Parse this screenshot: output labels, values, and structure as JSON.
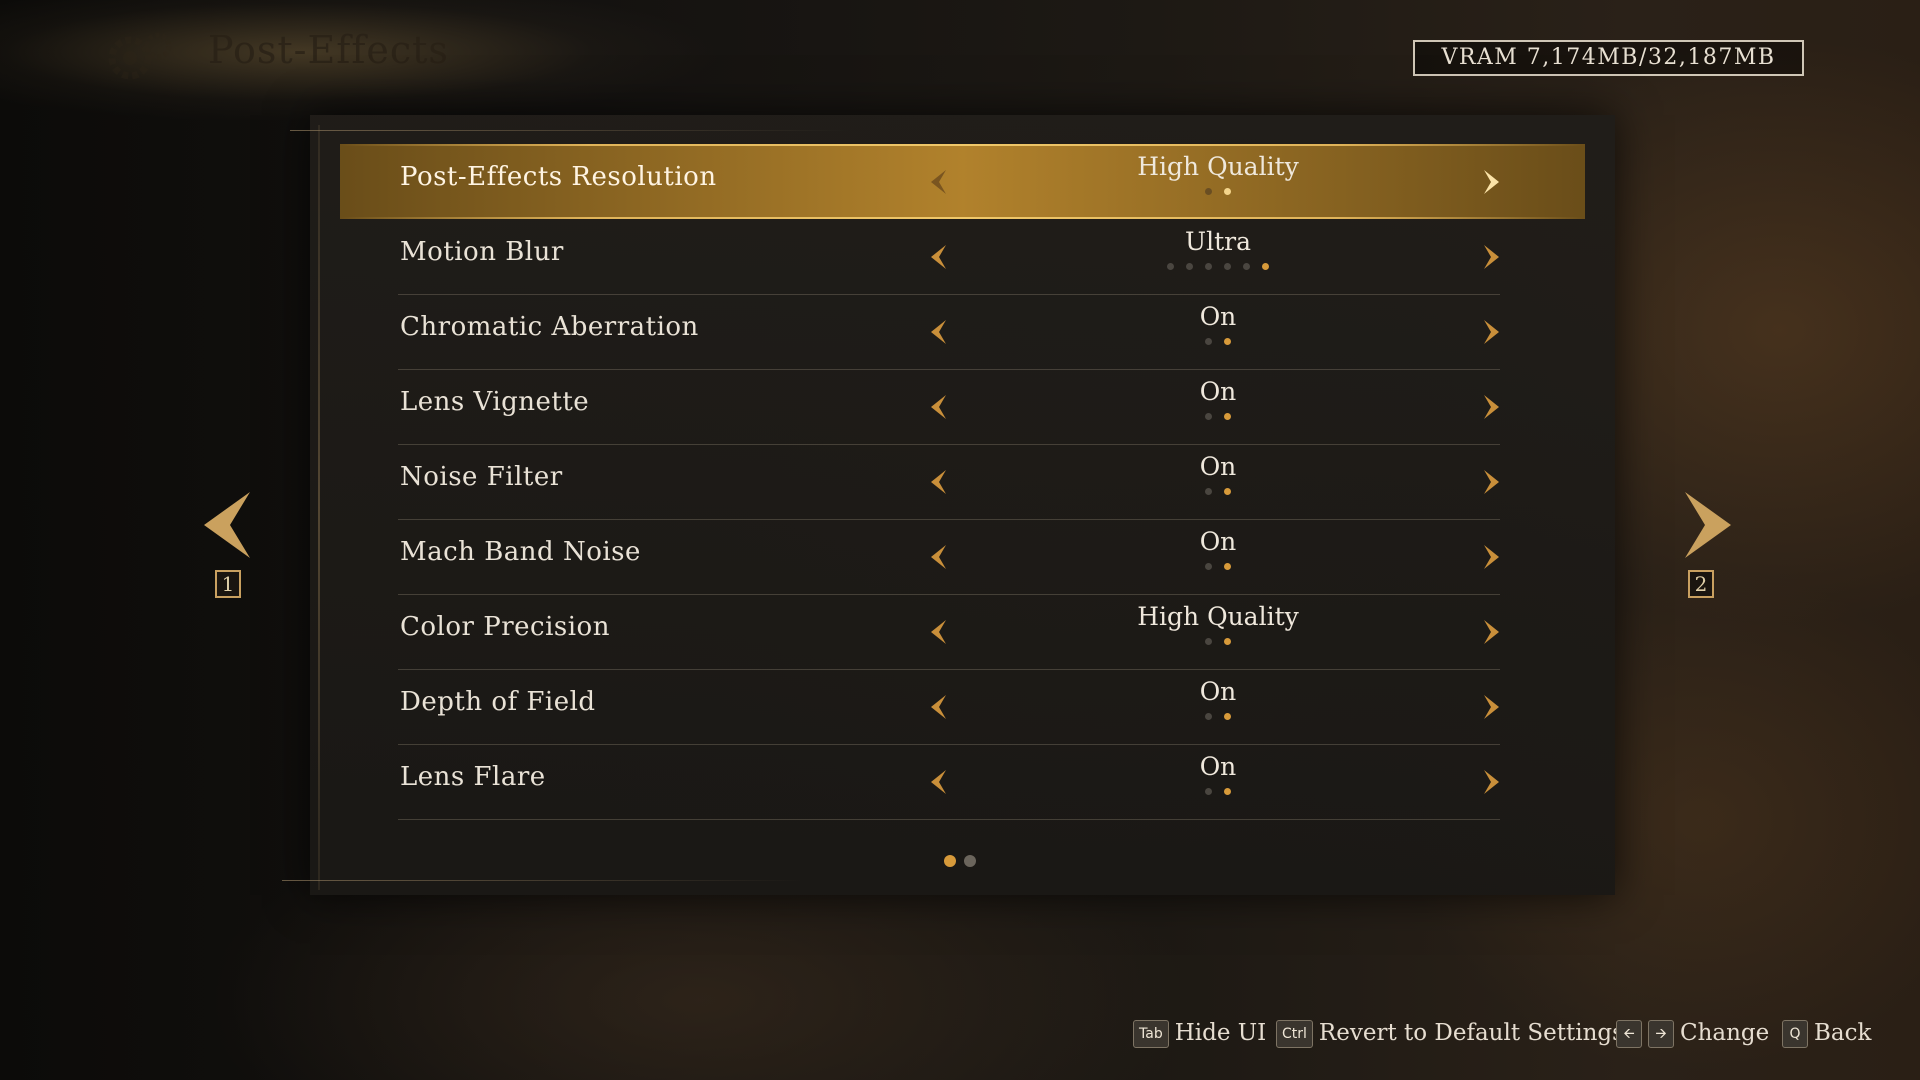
{
  "header": {
    "title": "Post-Effects",
    "title_icon": "gears-icon",
    "vram": "VRAM 7,174MB/32,187MB"
  },
  "settings": [
    {
      "label": "Post-Effects Resolution",
      "value": "High Quality",
      "options": 2,
      "selected_index": 1,
      "focused": true
    },
    {
      "label": "Motion Blur",
      "value": "Ultra",
      "options": 6,
      "selected_index": 5,
      "focused": false
    },
    {
      "label": "Chromatic Aberration",
      "value": "On",
      "options": 2,
      "selected_index": 1,
      "focused": false
    },
    {
      "label": "Lens Vignette",
      "value": "On",
      "options": 2,
      "selected_index": 1,
      "focused": false
    },
    {
      "label": "Noise Filter",
      "value": "On",
      "options": 2,
      "selected_index": 1,
      "focused": false
    },
    {
      "label": "Mach Band Noise",
      "value": "On",
      "options": 2,
      "selected_index": 1,
      "focused": false
    },
    {
      "label": "Color Precision",
      "value": "High Quality",
      "options": 2,
      "selected_index": 1,
      "focused": false
    },
    {
      "label": "Depth of Field",
      "value": "On",
      "options": 2,
      "selected_index": 1,
      "focused": false
    },
    {
      "label": "Lens Flare",
      "value": "On",
      "options": 2,
      "selected_index": 1,
      "focused": false
    }
  ],
  "pagination": {
    "pages": 2,
    "current_index": 0
  },
  "nav": {
    "prev_key": "1",
    "next_key": "2"
  },
  "footer": {
    "hide_ui": {
      "key": "Tab",
      "label": "Hide UI"
    },
    "revert": {
      "key": "Ctrl",
      "label": "Revert to Default Settings"
    },
    "change": {
      "label": "Change"
    },
    "back": {
      "key": "Q",
      "label": "Back"
    }
  },
  "colors": {
    "accent": "#d79a3a",
    "highlight_row": "#b9872d",
    "panel": "#1e1c19"
  }
}
